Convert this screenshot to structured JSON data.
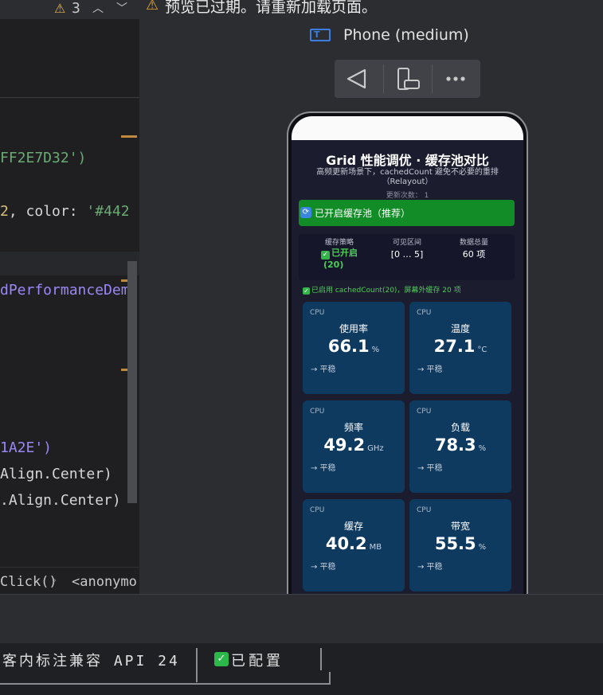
{
  "editor": {
    "warning_count": "3",
    "code_lines": [
      {
        "text": "FF2E7D32')",
        "kind": "str"
      },
      {
        "text": "2, color: '#442",
        "kind": "mixed"
      },
      {
        "text": "dPerformanceDem",
        "kind": "fn"
      },
      {
        "text": "1A2E')",
        "kind": "purple"
      },
      {
        "text": "Align.Center)",
        "kind": "txt"
      },
      {
        "text": ".Align.Center)",
        "kind": "txt"
      }
    ],
    "breadcrumbs": [
      "Click()",
      "<anonymo"
    ]
  },
  "preview": {
    "warning": "预览已过期。请重新加载页面。",
    "device_name": "Phone (medium)",
    "toolbar": {
      "back_label": "back",
      "rotate_label": "rotate",
      "more_label": "more"
    }
  },
  "app": {
    "title": "Grid 性能调优 · 缓存池对比",
    "subtitle": "高频更新场景下，cachedCount 避免不必要的重排（Relayout）",
    "update_count": "更新次数： 1",
    "cache_button": "已开启缓存池（推荐）",
    "stats": {
      "strategy_label": "缓存策略",
      "strategy_value": "已开启",
      "strategy_count": "(20)",
      "range_label": "可见区间",
      "range_value": "[0 … 5]",
      "total_label": "数据总量",
      "total_value": "60 项"
    },
    "note": "已启用 cachedCount(20)，屏幕外缓存 20 项",
    "tiles": [
      {
        "tag": "CPU",
        "name": "使用率",
        "value": "66.1",
        "unit": "%",
        "trend": "→ 平稳"
      },
      {
        "tag": "CPU",
        "name": "温度",
        "value": "27.1",
        "unit": "°C",
        "trend": "→ 平稳"
      },
      {
        "tag": "CPU",
        "name": "频率",
        "value": "49.2",
        "unit": "GHz",
        "trend": "→ 平稳"
      },
      {
        "tag": "CPU",
        "name": "负载",
        "value": "78.3",
        "unit": "%",
        "trend": "→ 平稳"
      },
      {
        "tag": "CPU",
        "name": "缓存",
        "value": "40.2",
        "unit": "MB",
        "trend": "→ 平稳"
      },
      {
        "tag": "CPU",
        "name": "带宽",
        "value": "55.5",
        "unit": "%",
        "trend": "→ 平稳"
      }
    ]
  },
  "statusbar": {
    "compat_text": "客内标注兼容 API 24",
    "config_text": "已配置"
  },
  "colors": {
    "accent_green": "#118c26",
    "tile_bg": "#0e3a60",
    "screen_bg": "#1b1c2e"
  }
}
